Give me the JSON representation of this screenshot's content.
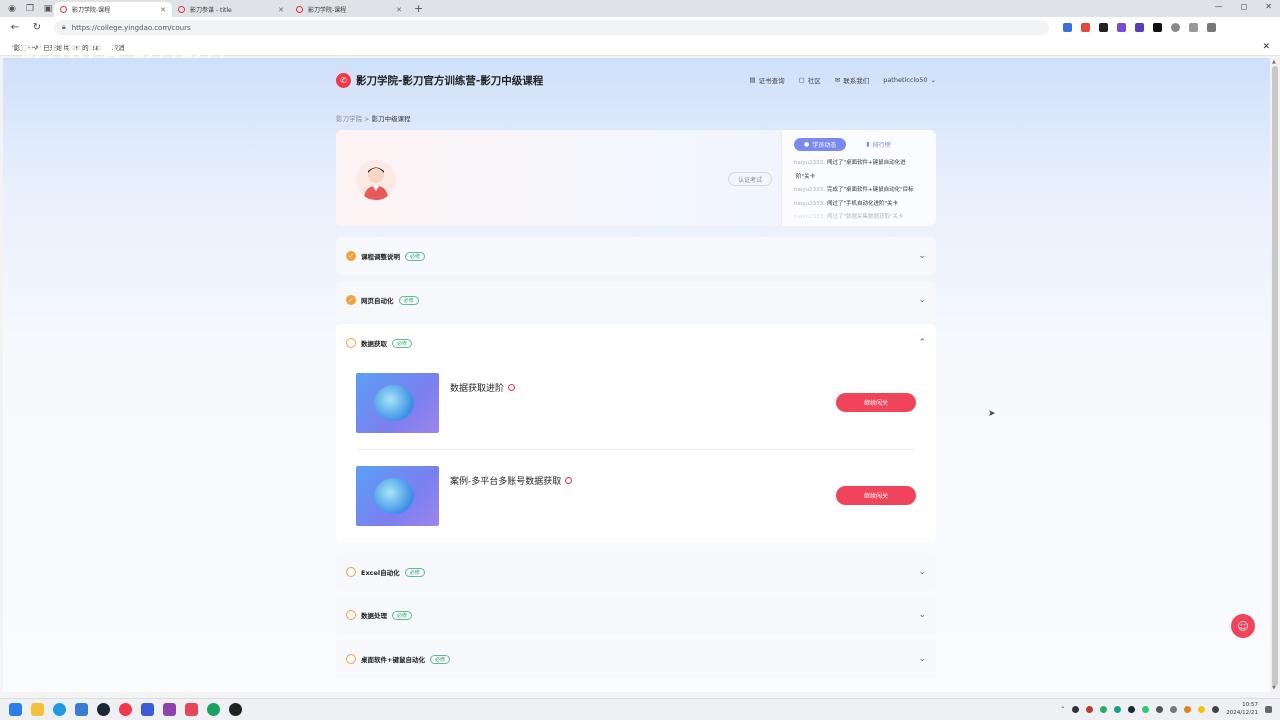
{
  "browser": {
    "tabs": [
      {
        "title": "影刀学院-课程",
        "active": true
      },
      {
        "title": "影刀参谋 - title",
        "active": false
      },
      {
        "title": "影刀学院-课程",
        "active": false
      }
    ],
    "url": "https://college.yingdao.com/cours",
    "notification": {
      "message": "'影刀RPA' 已开始共享你的屏幕",
      "cancel_label": "取消"
    },
    "watermark": "影刀RPA   影刀影刀"
  },
  "header": {
    "title": "影刀学院-影刀官方训练营-影刀中级课程",
    "nav": [
      {
        "icon": "certificate-icon",
        "label": "证书查询"
      },
      {
        "icon": "chat-icon",
        "label": "社区"
      },
      {
        "icon": "mail-icon",
        "label": "联系我们"
      }
    ],
    "user": "patheticclo50"
  },
  "breadcrumb": {
    "root": "影刀学院",
    "sep": ">",
    "current": "影刀中级课程"
  },
  "hero": {
    "cert_button": "认证考试",
    "feed_tabs": [
      "学员动态",
      "排行榜"
    ],
    "feed": [
      {
        "user": "haiyu2333:",
        "text": "闯过了\"桌面软件+键鼠自动化进"
      },
      {
        "user": "",
        "text": "阶\"关卡"
      },
      {
        "user": "haiyu2333:",
        "text": "完成了\"桌面软件+键鼠自动化\"目标"
      },
      {
        "user": "haiyu2333:",
        "text": "闯过了\"手机自动化进阶\"关卡"
      },
      {
        "user": "haiyu2333:",
        "text": "闯过了\"数据采集数据获取\"关卡"
      }
    ]
  },
  "sections": [
    {
      "title": "课程调整说明",
      "tag": "必修",
      "status": "done"
    },
    {
      "title": "网页自动化",
      "tag": "必修",
      "status": "done"
    },
    {
      "title": "数据获取",
      "tag": "必修",
      "status": "todo",
      "expanded": true
    },
    {
      "title": "Excel自动化",
      "tag": "必修",
      "status": "todo"
    },
    {
      "title": "数据处理",
      "tag": "必修",
      "status": "todo"
    },
    {
      "title": "桌面软件+键鼠自动化",
      "tag": "必修",
      "status": "todo"
    }
  ],
  "lessons": [
    {
      "title": "数据获取进阶",
      "button": "继续闯关"
    },
    {
      "title": "案例-多平台多账号数据获取",
      "button": "继续闯关"
    }
  ],
  "taskbar": {
    "time": "10:57",
    "date": "2024/12/21"
  }
}
